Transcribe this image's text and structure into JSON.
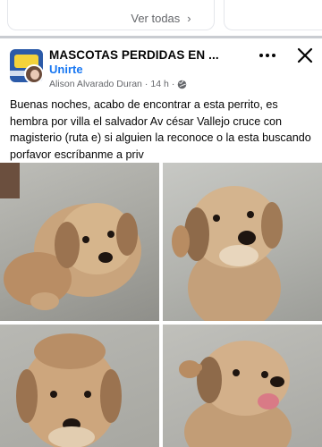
{
  "top": {
    "see_all_label": "Ver todas"
  },
  "post": {
    "group_name": "MASCOTAS PERDIDAS EN ...",
    "join_label": "Unirte",
    "author": "Alison Alvarado Duran",
    "time": "14 h",
    "body": "Buenas noches, acabo de encontrar a esta perrito, es hembra por villa el salvador Av césar Vallejo cruce con magisterio (ruta e) si alguien la reconoce o la esta buscando porfavor escríbanme a priv"
  },
  "icons": {
    "more": "more-horizontal-icon",
    "close": "close-icon",
    "privacy": "globe-icon",
    "see_all": "chevron-right-icon"
  },
  "colors": {
    "link_blue": "#1877f2",
    "secondary_text": "#65676b"
  }
}
